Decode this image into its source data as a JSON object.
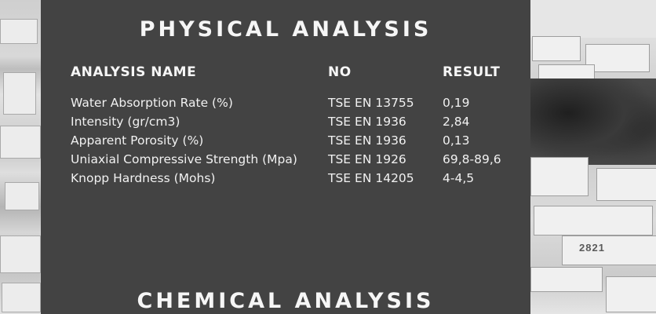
{
  "physical": {
    "title": "PHYSICAL ANALYSIS",
    "headers": {
      "name": "ANALYSIS NAME",
      "no": "NO",
      "result": "RESULT"
    },
    "rows": [
      {
        "name": "Water Absorption Rate (%)",
        "no": "TSE EN 13755",
        "result": "0,19"
      },
      {
        "name": "Intensity (gr/cm3)",
        "no": "TSE EN 1936",
        "result": "2,84"
      },
      {
        "name": "Apparent Porosity (%)",
        "no": "TSE EN 1936",
        "result": "0,13"
      },
      {
        "name": "Uniaxial Compressive Strength (Mpa)",
        "no": "TSE EN 1926",
        "result": "69,8-89,6"
      },
      {
        "name": "Knopp Hardness (Mohs)",
        "no": "TSE EN 14205",
        "result": "4-4,5"
      }
    ]
  },
  "chemical": {
    "title": "CHEMICAL ANALYSIS"
  },
  "background": {
    "block_marking": "2821"
  },
  "colors": {
    "panel": "#434343",
    "text": "#f4f4f4"
  }
}
